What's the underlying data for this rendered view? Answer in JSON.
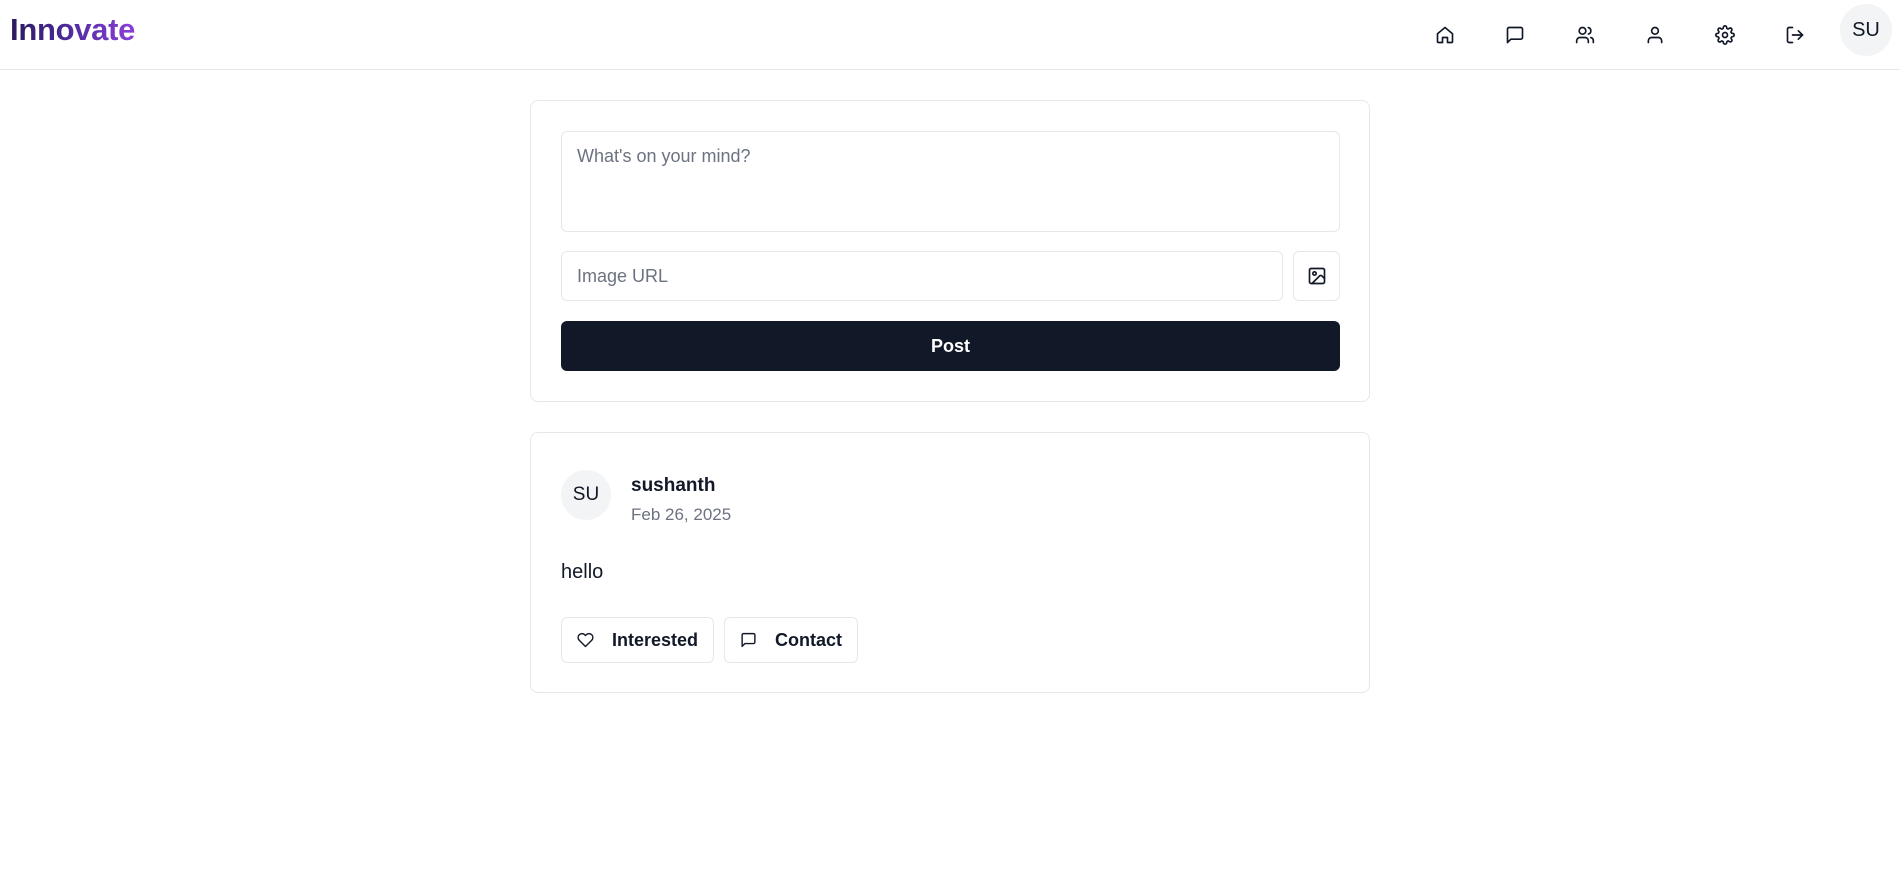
{
  "header": {
    "brand": "Innovate",
    "nav": [
      {
        "name": "home",
        "icon": "home-icon"
      },
      {
        "name": "messages",
        "icon": "message-square-icon"
      },
      {
        "name": "network",
        "icon": "users-icon"
      },
      {
        "name": "profile",
        "icon": "user-icon"
      },
      {
        "name": "settings",
        "icon": "gear-icon"
      },
      {
        "name": "logout",
        "icon": "log-out-icon"
      }
    ],
    "avatar_initials": "SU"
  },
  "composer": {
    "text_placeholder": "What's on your mind?",
    "text_value": "",
    "image_url_placeholder": "Image URL",
    "image_url_value": "",
    "image_button_icon": "image-icon",
    "post_label": "Post"
  },
  "posts": [
    {
      "avatar_initials": "SU",
      "username": "sushanth",
      "date": "Feb 26, 2025",
      "body": "hello",
      "actions": {
        "interested_label": "Interested",
        "interested_icon": "heart-icon",
        "contact_label": "Contact",
        "contact_icon": "message-square-icon"
      }
    }
  ],
  "colors": {
    "brand_gradient_start": "#2b1a5e",
    "brand_gradient_end": "#8b3fd9",
    "primary_button": "#111827",
    "border": "#e5e7eb",
    "muted_text": "#6b7280"
  }
}
